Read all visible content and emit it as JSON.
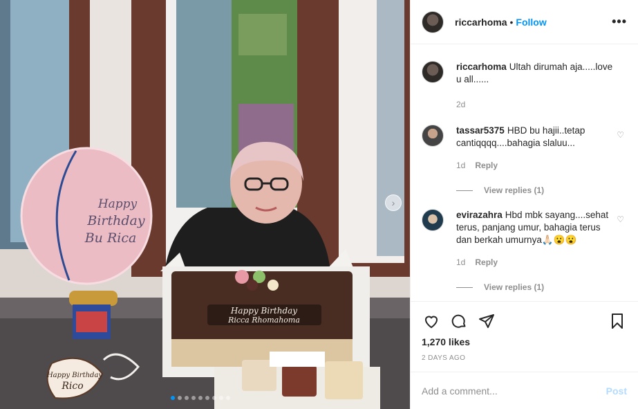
{
  "post": {
    "username": "riccarhoma",
    "separator": "•",
    "follow_label": "Follow",
    "more_label": "•••",
    "caption": {
      "username": "riccarhoma",
      "text": "Ultah dirumah aja.....love u all......",
      "age": "2d"
    },
    "comments": [
      {
        "username": "tassar5375",
        "text": "HBD bu hajii..tetap cantiqqqq....bahagia slaluu...",
        "age": "1d",
        "reply_label": "Reply",
        "view_replies": "View replies (1)"
      },
      {
        "username": "evirazahra",
        "text": "Hbd mbk sayang....sehat terus, panjang umur, bahagia terus dan berkah umurnya🙏🏻😮😮",
        "age": "1d",
        "reply_label": "Reply",
        "view_replies": "View replies (1)"
      }
    ],
    "likes": "1,270 likes",
    "date": "2 DAYS AGO",
    "add_comment_placeholder": "Add a comment...",
    "post_label": "Post"
  },
  "photo": {
    "balloon_text": [
      "Happy",
      "Birthday",
      "Bu Rica"
    ],
    "cake_text": [
      "Happy Birthday",
      "Ricca Rhomahoma"
    ],
    "topper_text": [
      "Happy Birthday",
      "Rico"
    ],
    "carousel_dots": 9,
    "active_dot": 0
  },
  "colors": {
    "accent": "#0095f6",
    "post_disabled": "#b3dbff",
    "muted": "#8e8e8e",
    "border": "#efefef"
  },
  "icons": [
    "heart-icon",
    "comment-icon",
    "share-icon",
    "bookmark-icon",
    "chevron-right-icon",
    "more-icon"
  ]
}
